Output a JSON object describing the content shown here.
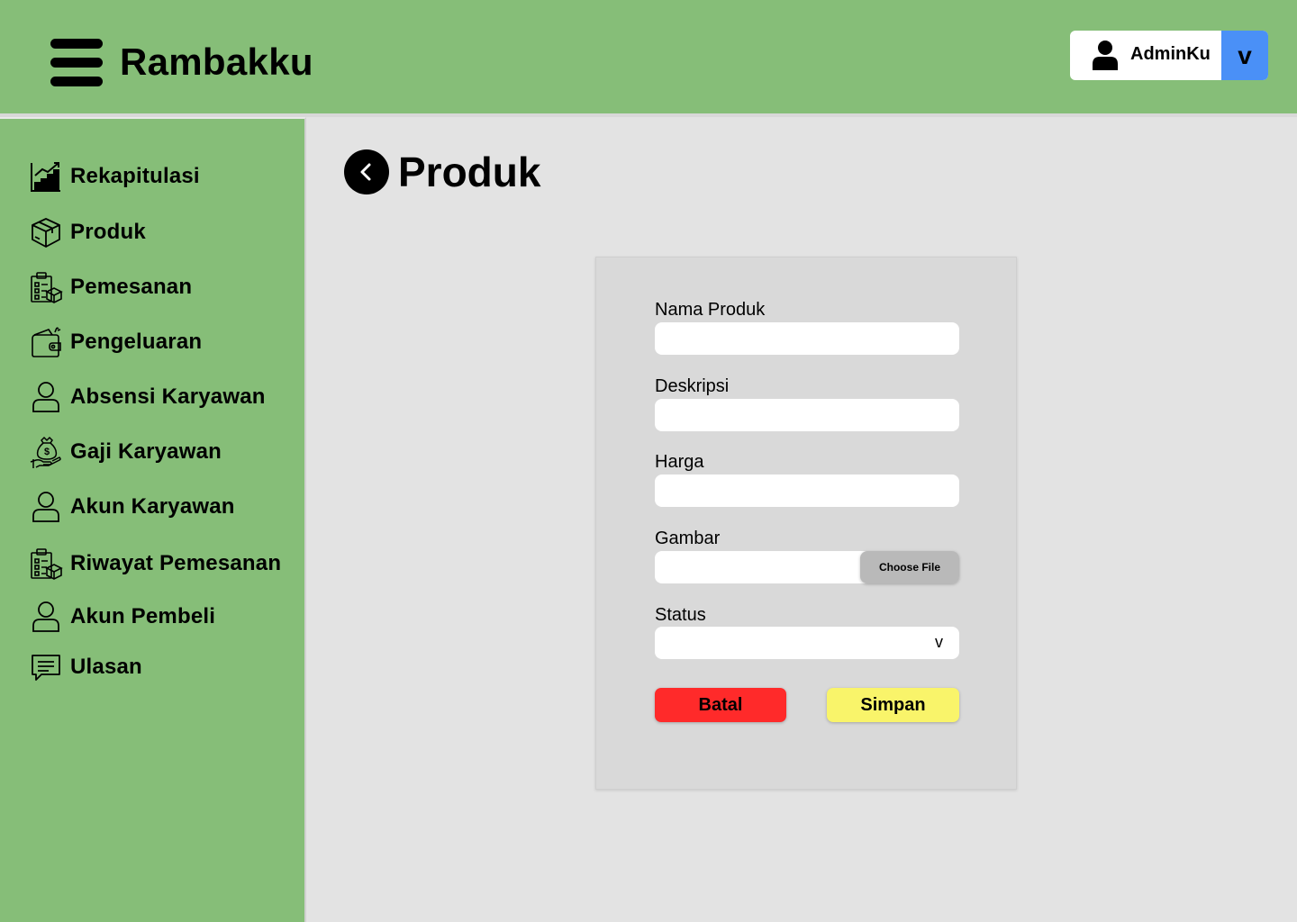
{
  "app": {
    "brand": "Rambakku"
  },
  "user": {
    "name": "AdminKu",
    "dropdown_label": "v"
  },
  "sidebar": {
    "items": [
      {
        "label": "Rekapitulasi",
        "icon": "chart-icon"
      },
      {
        "label": "Produk",
        "icon": "box-icon"
      },
      {
        "label": "Pemesanan",
        "icon": "order-clipboard-icon"
      },
      {
        "label": "Pengeluaran",
        "icon": "wallet-icon"
      },
      {
        "label": "Absensi Karyawan",
        "icon": "user-icon"
      },
      {
        "label": "Gaji Karyawan",
        "icon": "money-bag-hand-icon"
      },
      {
        "label": "Akun Karyawan",
        "icon": "user-icon"
      },
      {
        "label": "Riwayat Pemesanan",
        "icon": "order-clipboard-icon"
      },
      {
        "label": "Akun Pembeli",
        "icon": "user-icon"
      },
      {
        "label": "Ulasan",
        "icon": "chat-icon"
      }
    ]
  },
  "page": {
    "title": "Produk",
    "back_icon": "chevron-left-icon"
  },
  "form": {
    "nama_label": "Nama Produk",
    "nama_value": "",
    "deskripsi_label": "Deskripsi",
    "deskripsi_value": "",
    "harga_label": "Harga",
    "harga_value": "",
    "gambar_label": "Gambar",
    "choose_file_label": "Choose File",
    "status_label": "Status",
    "status_value": "",
    "status_arrow": "v",
    "batal_label": "Batal",
    "simpan_label": "Simpan"
  },
  "colors": {
    "header_green": "#86be78",
    "background": "#e3e3e3",
    "dropdown_blue": "#4a90f7",
    "batal_red": "#ff2a2a",
    "simpan_yellow": "#f9f46a"
  }
}
